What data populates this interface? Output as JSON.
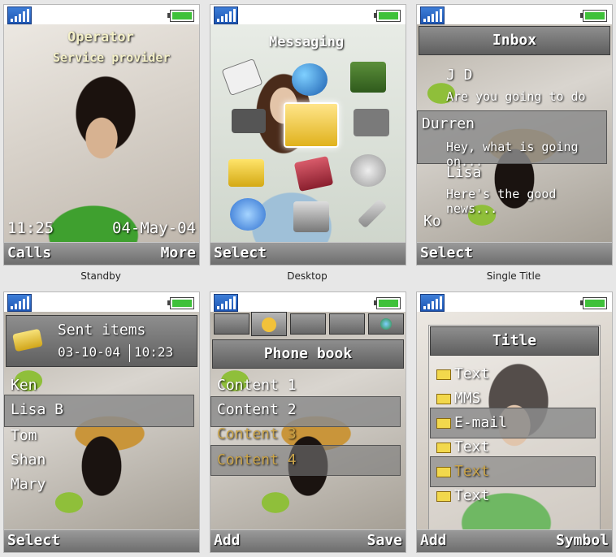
{
  "panels": [
    {
      "caption": "Standby",
      "operator": "Operator",
      "provider": "Service provider",
      "time": "11:25",
      "date": "04-May-04",
      "soft_left": "Calls",
      "soft_right": "More"
    },
    {
      "caption": "Desktop",
      "title": "Messaging",
      "soft_left": "Select"
    },
    {
      "caption": "Single Title",
      "title": "Inbox",
      "items": [
        {
          "name": "J D",
          "text": "Are you going to do"
        },
        {
          "name": "Durren",
          "text": "Hey, what is going on..."
        },
        {
          "name": "Lisa",
          "text": "Here's the good news..."
        },
        {
          "name": "Ko",
          "text": ""
        }
      ],
      "soft_left": "Select"
    },
    {
      "title": "Sent items",
      "date": "03-10-04",
      "time": "10:23",
      "items": [
        "Ken",
        "Lisa B",
        "Tom",
        "Shan",
        "Mary"
      ],
      "soft_left": "Select"
    },
    {
      "title": "Phone book",
      "items": [
        "Content 1",
        "Content 2",
        "Content 3",
        "Content 4"
      ],
      "soft_left": "Add",
      "soft_right": "Save"
    },
    {
      "title": "Title",
      "items": [
        "Text",
        "MMS",
        "E-mail",
        "Text",
        "Text",
        "Text"
      ],
      "soft_left": "Add",
      "soft_right": "Symbol"
    }
  ],
  "colors": {
    "battery": "#3fc13a",
    "signal": "#1d56b3",
    "bar": "#6d6d6d"
  }
}
